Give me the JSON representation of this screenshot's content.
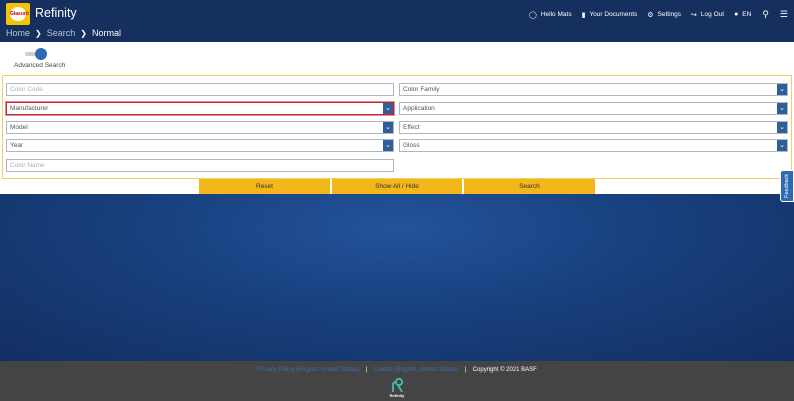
{
  "header": {
    "logo_text": "Glasurit",
    "app_title": "Refinity",
    "breadcrumb": [
      "Home",
      "Search",
      "Normal"
    ],
    "nav": [
      {
        "label": "Hello Mats",
        "icon": "user-icon"
      },
      {
        "label": "Your Documents",
        "icon": "folder-icon"
      },
      {
        "label": "Settings",
        "icon": "gear-icon"
      },
      {
        "label": "Log Out",
        "icon": "logout-icon"
      },
      {
        "label": "EN",
        "icon": "globe-icon"
      }
    ]
  },
  "search": {
    "toggle_label": "Advanced Search",
    "fields": {
      "color_code": "Color Code",
      "color_family": "Color Family",
      "manufacturer": "Manufacturer",
      "application": "Application",
      "model": "Model",
      "effect": "Effect",
      "year": "Year",
      "gloss": "Gloss",
      "color_name": "Color Name"
    },
    "buttons": {
      "reset": "Reset",
      "show_all": "Show All / Hide",
      "search": "Search"
    }
  },
  "feedback_label": "Feedback",
  "footer": {
    "privacy": "Privacy Policy (English, United States)",
    "credits": "Credits (English, United States)",
    "copyright": "Copyright © 2021 BASF",
    "logo_text": "Refinity"
  },
  "colors": {
    "header_bg": "#152f5e",
    "accent_yellow": "#f3b71b",
    "select_arrow": "#2e5f99",
    "highlight_red": "#c82333"
  }
}
